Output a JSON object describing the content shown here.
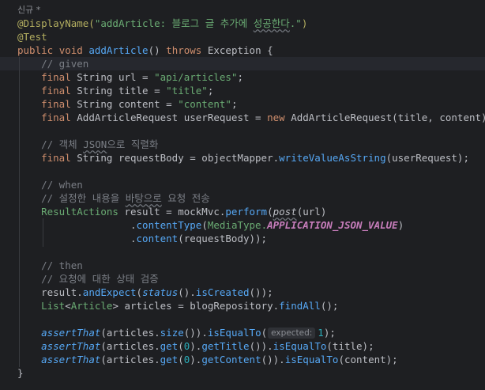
{
  "editor": {
    "theme_background": "#1e1f22",
    "usage_hint": "신규 *",
    "lines": [
      {
        "key": "l1",
        "segments": [
          {
            "t": "@DisplayName(",
            "c": "annotation"
          },
          {
            "t": "\"addArticle: 블로그 글 추가에 ",
            "c": "string"
          },
          {
            "t": "성공한다",
            "c": "string typo"
          },
          {
            "t": ".\"",
            "c": "string"
          },
          {
            "t": ")",
            "c": "annotation"
          }
        ]
      },
      {
        "key": "l2",
        "segments": [
          {
            "t": "@Test",
            "c": "annotation"
          }
        ]
      },
      {
        "key": "l3",
        "segments": [
          {
            "t": "public ",
            "c": "keyword"
          },
          {
            "t": "void ",
            "c": "keyword"
          },
          {
            "t": "addArticle",
            "c": "method-decl"
          },
          {
            "t": "() ",
            "c": "plain"
          },
          {
            "t": "throws ",
            "c": "keyword"
          },
          {
            "t": "Exception {",
            "c": "plain"
          }
        ]
      },
      {
        "key": "l4",
        "segments": [
          {
            "t": "    // given",
            "c": "comment"
          }
        ]
      },
      {
        "key": "l5",
        "segments": [
          {
            "t": "    final ",
            "c": "keyword"
          },
          {
            "t": "String url = ",
            "c": "plain"
          },
          {
            "t": "\"api/articles\"",
            "c": "string"
          },
          {
            "t": ";",
            "c": "plain"
          }
        ]
      },
      {
        "key": "l6",
        "segments": [
          {
            "t": "    final ",
            "c": "keyword"
          },
          {
            "t": "String title = ",
            "c": "plain"
          },
          {
            "t": "\"title\"",
            "c": "string"
          },
          {
            "t": ";",
            "c": "plain"
          }
        ]
      },
      {
        "key": "l7",
        "segments": [
          {
            "t": "    final ",
            "c": "keyword"
          },
          {
            "t": "String content = ",
            "c": "plain"
          },
          {
            "t": "\"content\"",
            "c": "string"
          },
          {
            "t": ";",
            "c": "plain"
          }
        ]
      },
      {
        "key": "l8",
        "segments": [
          {
            "t": "    final ",
            "c": "keyword"
          },
          {
            "t": "AddArticleRequest userRequest = ",
            "c": "plain"
          },
          {
            "t": "new ",
            "c": "keyword"
          },
          {
            "t": "AddArticleRequest(title, content);",
            "c": "plain"
          }
        ]
      },
      {
        "key": "l9",
        "segments": []
      },
      {
        "key": "l10",
        "segments": [
          {
            "t": "    // 객체 ",
            "c": "comment"
          },
          {
            "t": "JSON",
            "c": "comment typo"
          },
          {
            "t": "으로 직렬화",
            "c": "comment"
          }
        ]
      },
      {
        "key": "l11",
        "segments": [
          {
            "t": "    final ",
            "c": "keyword"
          },
          {
            "t": "String requestBody = objectMapper.",
            "c": "plain"
          },
          {
            "t": "writeValueAsString",
            "c": "method-call"
          },
          {
            "t": "(userRequest);",
            "c": "plain"
          }
        ]
      },
      {
        "key": "l12",
        "segments": []
      },
      {
        "key": "l13",
        "segments": [
          {
            "t": "    // when",
            "c": "comment"
          }
        ]
      },
      {
        "key": "l14",
        "segments": [
          {
            "t": "    // 설정한 내용을 ",
            "c": "comment"
          },
          {
            "t": "바탕으로",
            "c": "comment typo"
          },
          {
            "t": " 요청 전송",
            "c": "comment"
          }
        ]
      },
      {
        "key": "l15",
        "segments": [
          {
            "t": "    ResultActions ",
            "c": "string"
          },
          {
            "t": "result = mockMvc.",
            "c": "plain"
          },
          {
            "t": "perform",
            "c": "method-call"
          },
          {
            "t": "(",
            "c": "plain"
          },
          {
            "t": "post",
            "c": "static-italic typo"
          },
          {
            "t": "(url)",
            "c": "plain"
          }
        ]
      },
      {
        "key": "l16",
        "segments": [
          {
            "t": "                   .",
            "c": "plain"
          },
          {
            "t": "contentType",
            "c": "method-call"
          },
          {
            "t": "(",
            "c": "plain"
          },
          {
            "t": "MediaType.",
            "c": "string"
          },
          {
            "t": "APPLICATION_JSON_VALUE",
            "c": "field-const"
          },
          {
            "t": ")",
            "c": "plain"
          }
        ]
      },
      {
        "key": "l17",
        "segments": [
          {
            "t": "                   .",
            "c": "plain"
          },
          {
            "t": "content",
            "c": "method-call"
          },
          {
            "t": "(requestBody));",
            "c": "plain"
          }
        ]
      },
      {
        "key": "l18",
        "segments": []
      },
      {
        "key": "l19",
        "segments": [
          {
            "t": "    // then",
            "c": "comment"
          }
        ]
      },
      {
        "key": "l20",
        "segments": [
          {
            "t": "    // 요청에 대한 상태 검증",
            "c": "comment"
          }
        ]
      },
      {
        "key": "l21",
        "segments": [
          {
            "t": "    result.",
            "c": "plain"
          },
          {
            "t": "andExpect",
            "c": "method-call"
          },
          {
            "t": "(",
            "c": "plain"
          },
          {
            "t": "status",
            "c": "static-call"
          },
          {
            "t": "().",
            "c": "plain"
          },
          {
            "t": "isCreated",
            "c": "method-call"
          },
          {
            "t": "());",
            "c": "plain"
          }
        ]
      },
      {
        "key": "l22",
        "segments": [
          {
            "t": "    List",
            "c": "string"
          },
          {
            "t": "<",
            "c": "plain"
          },
          {
            "t": "Article",
            "c": "string"
          },
          {
            "t": "> articles = blogRepository.",
            "c": "plain"
          },
          {
            "t": "findAll",
            "c": "method-call"
          },
          {
            "t": "();",
            "c": "plain"
          }
        ]
      },
      {
        "key": "l23",
        "segments": []
      },
      {
        "key": "l24",
        "segments": [
          {
            "t": "    ",
            "c": "plain"
          },
          {
            "t": "assertThat",
            "c": "static-call"
          },
          {
            "t": "(articles.",
            "c": "plain"
          },
          {
            "t": "size",
            "c": "method-call"
          },
          {
            "t": "()).",
            "c": "plain"
          },
          {
            "t": "isEqualTo",
            "c": "method-call"
          },
          {
            "t": "(",
            "c": "plain"
          },
          {
            "t": "expected:",
            "c": "param-hint"
          },
          {
            "t": "1",
            "c": "number"
          },
          {
            "t": ");",
            "c": "plain"
          }
        ]
      },
      {
        "key": "l25",
        "segments": [
          {
            "t": "    ",
            "c": "plain"
          },
          {
            "t": "assertThat",
            "c": "static-call"
          },
          {
            "t": "(articles.",
            "c": "plain"
          },
          {
            "t": "get",
            "c": "method-call"
          },
          {
            "t": "(",
            "c": "plain"
          },
          {
            "t": "0",
            "c": "number"
          },
          {
            "t": ").",
            "c": "plain"
          },
          {
            "t": "getTitle",
            "c": "method-call"
          },
          {
            "t": "()).",
            "c": "plain"
          },
          {
            "t": "isEqualTo",
            "c": "method-call"
          },
          {
            "t": "(title);",
            "c": "plain"
          }
        ]
      },
      {
        "key": "l26",
        "segments": [
          {
            "t": "    ",
            "c": "plain"
          },
          {
            "t": "assertThat",
            "c": "static-call"
          },
          {
            "t": "(articles.",
            "c": "plain"
          },
          {
            "t": "get",
            "c": "method-call"
          },
          {
            "t": "(",
            "c": "plain"
          },
          {
            "t": "0",
            "c": "number"
          },
          {
            "t": ").",
            "c": "plain"
          },
          {
            "t": "getContent",
            "c": "method-call"
          },
          {
            "t": "()).",
            "c": "plain"
          },
          {
            "t": "isEqualTo",
            "c": "method-call"
          },
          {
            "t": "(content);",
            "c": "plain"
          }
        ]
      },
      {
        "key": "l27",
        "segments": [
          {
            "t": "}",
            "c": "plain"
          }
        ]
      }
    ]
  }
}
